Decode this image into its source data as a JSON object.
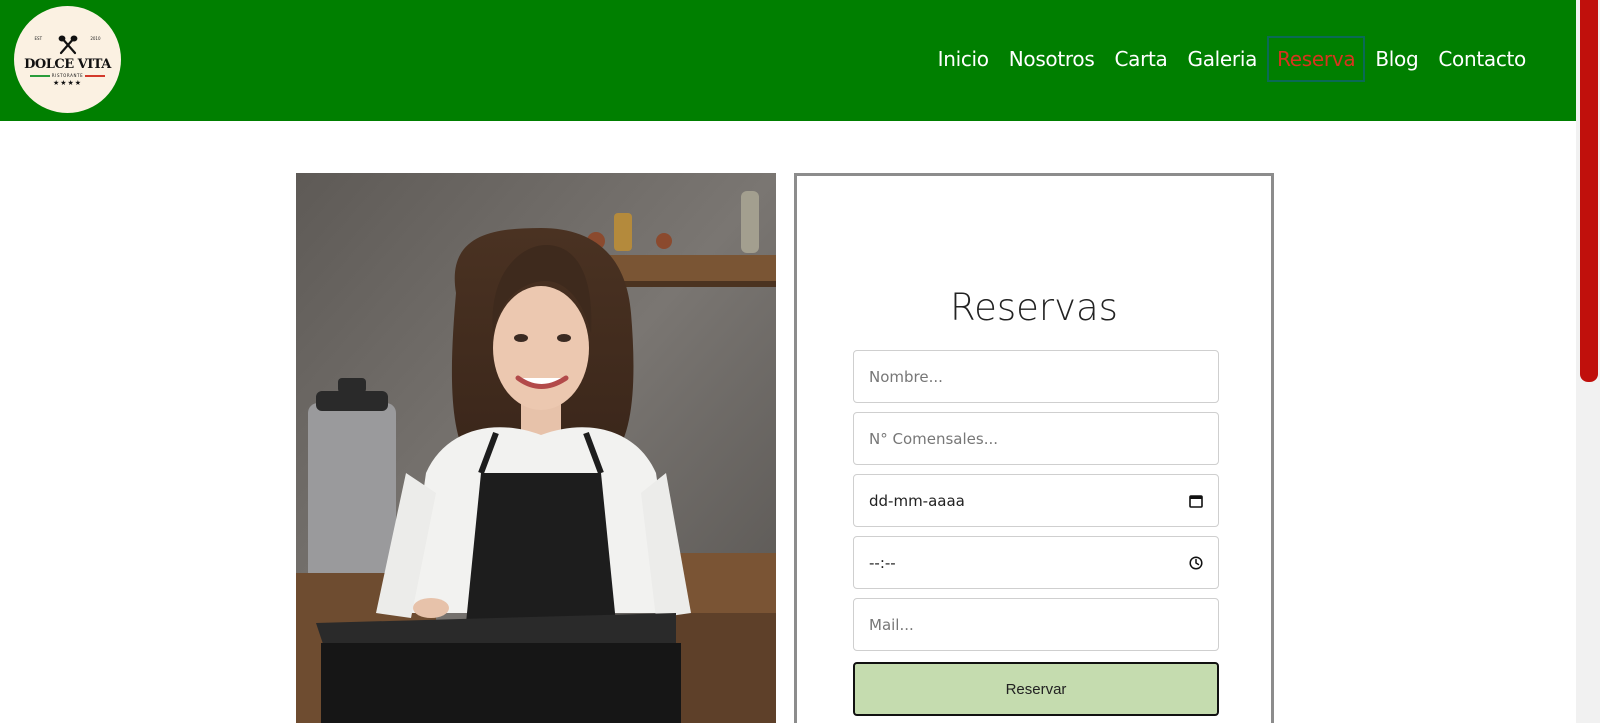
{
  "header": {
    "logo": {
      "est_left": "EST",
      "est_right": "2010",
      "brand": "DOLCE VITA",
      "subtitle": "RISTORANTE",
      "stars": "★★★★"
    },
    "nav": [
      {
        "label": "Inicio"
      },
      {
        "label": "Nosotros"
      },
      {
        "label": "Carta"
      },
      {
        "label": "Galeria"
      },
      {
        "label": "Reserva",
        "active": true
      },
      {
        "label": "Blog"
      },
      {
        "label": "Contacto"
      }
    ]
  },
  "form": {
    "title": "Reservas",
    "name_placeholder": "Nombre...",
    "guests_placeholder": "N° Comensales...",
    "date_value": "dd-mm-aaaa",
    "time_value": "--:--",
    "mail_placeholder": "Mail...",
    "submit_label": "Reservar"
  },
  "icons": {
    "date": "calendar-icon",
    "time": "clock-icon"
  },
  "colors": {
    "header_bg": "#007f00",
    "nav_active": "#d8341e",
    "submit_bg": "#c5dcaf",
    "scroll_thumb": "#c0100c"
  }
}
